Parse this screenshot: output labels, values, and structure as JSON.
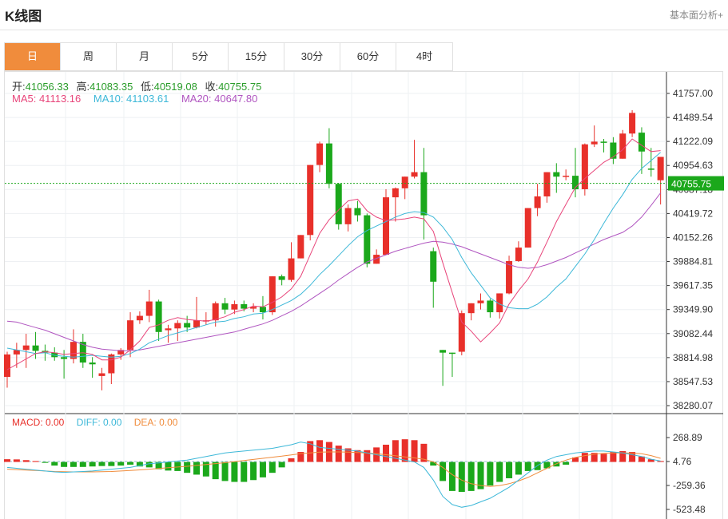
{
  "header": {
    "title": "K线图",
    "link": "基本面分析+"
  },
  "tabs": [
    {
      "label": "日",
      "active": true
    },
    {
      "label": "周",
      "active": false
    },
    {
      "label": "月",
      "active": false
    },
    {
      "label": "5分",
      "active": false
    },
    {
      "label": "15分",
      "active": false
    },
    {
      "label": "30分",
      "active": false
    },
    {
      "label": "60分",
      "active": false
    },
    {
      "label": "4时",
      "active": false
    }
  ],
  "ohlc": {
    "open_label": "开:",
    "open": "41056.33",
    "high_label": "高:",
    "high": "41083.35",
    "low_label": "低:",
    "low": "40519.08",
    "close_label": "收:",
    "close": "40755.75"
  },
  "ma": {
    "ma5": "MA5: 41113.16",
    "ma10": "MA10: 41103.61",
    "ma20": "MA20: 40647.80",
    "ma5_color": "#e8457a",
    "ma10_color": "#3db8d8",
    "ma20_color": "#b055c0"
  },
  "macd_legend": {
    "macd": "MACD: 0.00",
    "diff": "DIFF: 0.00",
    "dea": "DEA: 0.00",
    "macd_color": "#e8302a",
    "diff_color": "#3db8d8",
    "dea_color": "#f08c3c"
  },
  "colors": {
    "up": "#e8302a",
    "down": "#1ba81b",
    "last_line": "#1ba81b"
  },
  "chart_data": {
    "type": "candlestick",
    "price_axis": {
      "ticks": [
        "41757.00",
        "41489.54",
        "41222.09",
        "40954.63",
        "40687.18",
        "40419.72",
        "40152.26",
        "39884.81",
        "39617.35",
        "39349.90",
        "39082.44",
        "38814.98",
        "38547.53",
        "38280.07"
      ],
      "range": [
        38280.07,
        41757.0
      ],
      "last_price_label": "40755.75"
    },
    "macd_axis": {
      "ticks": [
        "268.89",
        "4.76",
        "-259.36",
        "-523.48"
      ],
      "range": [
        -523.48,
        268.89
      ]
    },
    "candles": [
      {
        "o": 38600,
        "h": 38880,
        "l": 38480,
        "c": 38850
      },
      {
        "o": 38850,
        "h": 38980,
        "l": 38700,
        "c": 38900
      },
      {
        "o": 38900,
        "h": 39080,
        "l": 38700,
        "c": 38950
      },
      {
        "o": 38950,
        "h": 39100,
        "l": 38800,
        "c": 38890
      },
      {
        "o": 38890,
        "h": 38960,
        "l": 38780,
        "c": 38870
      },
      {
        "o": 38870,
        "h": 38930,
        "l": 38780,
        "c": 38820
      },
      {
        "o": 38820,
        "h": 38900,
        "l": 38580,
        "c": 38800
      },
      {
        "o": 38800,
        "h": 39130,
        "l": 38750,
        "c": 38990
      },
      {
        "o": 38990,
        "h": 39080,
        "l": 38700,
        "c": 38760
      },
      {
        "o": 38760,
        "h": 38820,
        "l": 38590,
        "c": 38740
      },
      {
        "o": 38610,
        "h": 38700,
        "l": 38450,
        "c": 38640
      },
      {
        "o": 38640,
        "h": 38860,
        "l": 38520,
        "c": 38850
      },
      {
        "o": 38850,
        "h": 38920,
        "l": 38790,
        "c": 38900
      },
      {
        "o": 38900,
        "h": 39320,
        "l": 38820,
        "c": 39230
      },
      {
        "o": 39230,
        "h": 39330,
        "l": 39190,
        "c": 39280
      },
      {
        "o": 39280,
        "h": 39570,
        "l": 39210,
        "c": 39440
      },
      {
        "o": 39440,
        "h": 39460,
        "l": 39000,
        "c": 39100
      },
      {
        "o": 39120,
        "h": 39180,
        "l": 38980,
        "c": 39140
      },
      {
        "o": 39140,
        "h": 39230,
        "l": 39000,
        "c": 39200
      },
      {
        "o": 39200,
        "h": 39280,
        "l": 39100,
        "c": 39150
      },
      {
        "o": 39150,
        "h": 39490,
        "l": 39140,
        "c": 39230
      },
      {
        "o": 39230,
        "h": 39320,
        "l": 39180,
        "c": 39230
      },
      {
        "o": 39230,
        "h": 39440,
        "l": 39160,
        "c": 39420
      },
      {
        "o": 39420,
        "h": 39480,
        "l": 39300,
        "c": 39350
      },
      {
        "o": 39350,
        "h": 39450,
        "l": 39300,
        "c": 39410
      },
      {
        "o": 39410,
        "h": 39450,
        "l": 39330,
        "c": 39360
      },
      {
        "o": 39360,
        "h": 39420,
        "l": 39320,
        "c": 39380
      },
      {
        "o": 39380,
        "h": 39500,
        "l": 39240,
        "c": 39320
      },
      {
        "o": 39320,
        "h": 39720,
        "l": 39290,
        "c": 39720
      },
      {
        "o": 39720,
        "h": 39740,
        "l": 39620,
        "c": 39680
      },
      {
        "o": 39680,
        "h": 40100,
        "l": 39660,
        "c": 39920
      },
      {
        "o": 39920,
        "h": 40120,
        "l": 39920,
        "c": 40180
      },
      {
        "o": 40180,
        "h": 40290,
        "l": 40120,
        "c": 40960
      },
      {
        "o": 40960,
        "h": 41220,
        "l": 40880,
        "c": 41200
      },
      {
        "o": 41200,
        "h": 41370,
        "l": 40700,
        "c": 40750
      },
      {
        "o": 40750,
        "h": 40760,
        "l": 40240,
        "c": 40300
      },
      {
        "o": 40300,
        "h": 40520,
        "l": 40220,
        "c": 40480
      },
      {
        "o": 40480,
        "h": 40560,
        "l": 40330,
        "c": 40400
      },
      {
        "o": 40400,
        "h": 40420,
        "l": 39820,
        "c": 39860
      },
      {
        "o": 39860,
        "h": 40020,
        "l": 39860,
        "c": 39960
      },
      {
        "o": 39960,
        "h": 40690,
        "l": 39960,
        "c": 40600
      },
      {
        "o": 40600,
        "h": 40710,
        "l": 40330,
        "c": 40700
      },
      {
        "o": 40700,
        "h": 40760,
        "l": 40580,
        "c": 40830
      },
      {
        "o": 40830,
        "h": 41240,
        "l": 40810,
        "c": 40880
      },
      {
        "o": 40880,
        "h": 41150,
        "l": 40130,
        "c": 40400
      },
      {
        "o": 40000,
        "h": 40040,
        "l": 39370,
        "c": 39660
      },
      {
        "o": 38900,
        "h": 38890,
        "l": 38500,
        "c": 38870
      },
      {
        "o": 38870,
        "h": 38860,
        "l": 38600,
        "c": 38860
      },
      {
        "o": 38880,
        "h": 39340,
        "l": 38840,
        "c": 39310
      },
      {
        "o": 39310,
        "h": 39400,
        "l": 39230,
        "c": 39420
      },
      {
        "o": 39420,
        "h": 39530,
        "l": 39350,
        "c": 39450
      },
      {
        "o": 39450,
        "h": 39470,
        "l": 39260,
        "c": 39320
      },
      {
        "o": 39320,
        "h": 39490,
        "l": 39250,
        "c": 39530
      },
      {
        "o": 39530,
        "h": 39950,
        "l": 39520,
        "c": 39890
      },
      {
        "o": 39890,
        "h": 40110,
        "l": 39880,
        "c": 40040
      },
      {
        "o": 40040,
        "h": 40480,
        "l": 40360,
        "c": 40480
      },
      {
        "o": 40480,
        "h": 40750,
        "l": 40390,
        "c": 40610
      },
      {
        "o": 40610,
        "h": 40870,
        "l": 40540,
        "c": 40880
      },
      {
        "o": 40880,
        "h": 40980,
        "l": 40650,
        "c": 40830
      },
      {
        "o": 40830,
        "h": 40910,
        "l": 40790,
        "c": 40840
      },
      {
        "o": 40840,
        "h": 41150,
        "l": 40600,
        "c": 40690
      },
      {
        "o": 40690,
        "h": 41200,
        "l": 40620,
        "c": 41190
      },
      {
        "o": 41190,
        "h": 41400,
        "l": 41160,
        "c": 41220
      },
      {
        "o": 41220,
        "h": 41250,
        "l": 41100,
        "c": 41210
      },
      {
        "o": 41210,
        "h": 41270,
        "l": 40970,
        "c": 41030
      },
      {
        "o": 41030,
        "h": 41350,
        "l": 41040,
        "c": 41310
      },
      {
        "o": 41310,
        "h": 41570,
        "l": 41270,
        "c": 41540
      },
      {
        "o": 41320,
        "h": 41380,
        "l": 40860,
        "c": 41110
      },
      {
        "o": 40920,
        "h": 41150,
        "l": 40830,
        "c": 40910
      },
      {
        "o": 40790,
        "h": 40540,
        "l": 40520,
        "c": 41050
      }
    ],
    "ma5": [
      38680,
      38740,
      38800,
      38860,
      38880,
      38870,
      38850,
      38860,
      38870,
      38850,
      38790,
      38790,
      38820,
      38900,
      39000,
      39150,
      39180,
      39230,
      39260,
      39240,
      39230,
      39220,
      39240,
      39270,
      39320,
      39350,
      39390,
      39380,
      39430,
      39490,
      39580,
      39720,
      39960,
      40200,
      40350,
      40460,
      40560,
      40580,
      40450,
      40380,
      40340,
      40350,
      40360,
      40380,
      40360,
      40220,
      39870,
      39540,
      39210,
      39110,
      38990,
      39090,
      39200,
      39410,
      39560,
      39690,
      39880,
      40100,
      40330,
      40520,
      40710,
      40810,
      40900,
      40990,
      41050,
      41130,
      41250,
      41180,
      41110,
      41120
    ],
    "ma10": [
      38920,
      38900,
      38880,
      38860,
      38870,
      38840,
      38830,
      38820,
      38830,
      38840,
      38830,
      38820,
      38830,
      38860,
      38910,
      38980,
      39020,
      39060,
      39090,
      39120,
      39150,
      39180,
      39210,
      39220,
      39250,
      39270,
      39300,
      39310,
      39350,
      39400,
      39450,
      39520,
      39620,
      39740,
      39840,
      39950,
      40060,
      40160,
      40230,
      40280,
      40330,
      40380,
      40420,
      40440,
      40430,
      40380,
      40270,
      40130,
      39930,
      39760,
      39620,
      39480,
      39410,
      39370,
      39360,
      39360,
      39410,
      39490,
      39600,
      39690,
      39830,
      39970,
      40130,
      40310,
      40480,
      40630,
      40800,
      40920,
      41010,
      41100
    ],
    "ma20": [
      39220,
      39210,
      39180,
      39150,
      39120,
      39080,
      39040,
      39000,
      38960,
      38930,
      38910,
      38900,
      38890,
      38890,
      38900,
      38920,
      38940,
      38960,
      38980,
      39000,
      39020,
      39040,
      39060,
      39080,
      39100,
      39130,
      39160,
      39190,
      39230,
      39280,
      39330,
      39390,
      39460,
      39530,
      39600,
      39680,
      39750,
      39820,
      39880,
      39920,
      39960,
      40000,
      40030,
      40060,
      40090,
      40110,
      40100,
      40080,
      40050,
      40010,
      39970,
      39930,
      39890,
      39850,
      39820,
      39810,
      39820,
      39850,
      39890,
      39930,
      39980,
      40030,
      40080,
      40130,
      40170,
      40210,
      40280,
      40380,
      40510,
      40648
    ],
    "macd_hist": [
      30,
      28,
      20,
      10,
      -10,
      -40,
      -55,
      -55,
      -55,
      -50,
      -45,
      -45,
      -40,
      -30,
      -50,
      -60,
      -80,
      -95,
      -100,
      -120,
      -140,
      -160,
      -190,
      -210,
      -220,
      -220,
      -200,
      -170,
      -120,
      -60,
      40,
      110,
      230,
      240,
      220,
      180,
      150,
      130,
      130,
      160,
      190,
      240,
      250,
      240,
      200,
      -40,
      -210,
      -320,
      -330,
      -320,
      -300,
      -260,
      -220,
      -180,
      -140,
      -100,
      -90,
      -70,
      -50,
      -30,
      50,
      100,
      100,
      90,
      110,
      120,
      110,
      60,
      30,
      10
    ],
    "diff": [
      -60,
      -70,
      -80,
      -90,
      -100,
      -110,
      -115,
      -110,
      -105,
      -100,
      -90,
      -80,
      -70,
      -60,
      -40,
      -20,
      -10,
      0,
      10,
      20,
      40,
      60,
      80,
      100,
      110,
      120,
      130,
      140,
      150,
      170,
      190,
      220,
      200,
      160,
      150,
      140,
      130,
      120,
      100,
      80,
      60,
      40,
      20,
      0,
      -60,
      -200,
      -380,
      -470,
      -500,
      -480,
      -440,
      -400,
      -340,
      -280,
      -200,
      -120,
      -40,
      20,
      60,
      80,
      100,
      110,
      120,
      120,
      110,
      100,
      80,
      60,
      30,
      10
    ],
    "dea": [
      -80,
      -85,
      -90,
      -95,
      -100,
      -105,
      -108,
      -110,
      -110,
      -110,
      -108,
      -105,
      -100,
      -95,
      -88,
      -80,
      -72,
      -64,
      -56,
      -48,
      -38,
      -28,
      -18,
      -8,
      4,
      16,
      28,
      40,
      52,
      64,
      78,
      92,
      100,
      108,
      110,
      110,
      108,
      104,
      98,
      90,
      80,
      68,
      56,
      44,
      30,
      0,
      -60,
      -140,
      -200,
      -240,
      -260,
      -270,
      -260,
      -240,
      -210,
      -170,
      -120,
      -70,
      -20,
      20,
      50,
      70,
      85,
      95,
      100,
      100,
      98,
      90,
      70,
      40
    ]
  }
}
